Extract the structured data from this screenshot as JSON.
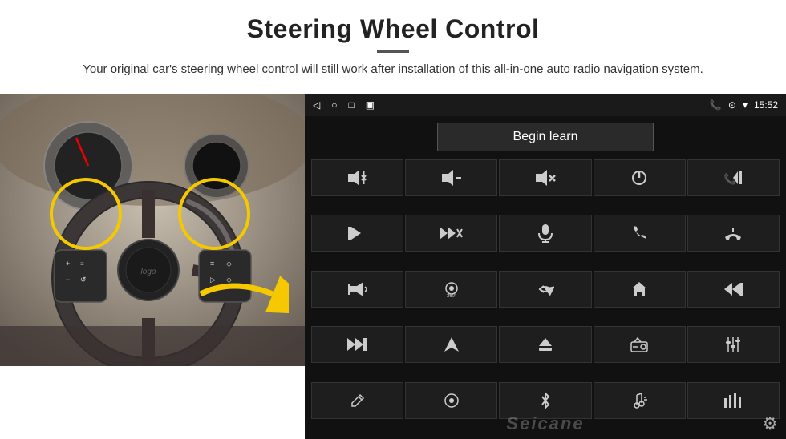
{
  "header": {
    "title": "Steering Wheel Control",
    "subtitle": "Your original car's steering wheel control will still work after installation of this all-in-one auto radio navigation system."
  },
  "status_bar": {
    "time": "15:52",
    "back_icon": "◁",
    "home_icon": "○",
    "recents_icon": "□",
    "sd_icon": "▣",
    "phone_icon": "📞",
    "location_icon": "⊙",
    "wifi_icon": "▾"
  },
  "begin_learn": {
    "label": "Begin learn"
  },
  "grid_icons": [
    {
      "icon": "🔊+",
      "name": "volume-up"
    },
    {
      "icon": "🔊−",
      "name": "volume-down"
    },
    {
      "icon": "🔇",
      "name": "mute"
    },
    {
      "icon": "⏻",
      "name": "power"
    },
    {
      "icon": "⏮",
      "name": "prev-track-phone"
    },
    {
      "icon": "⏭",
      "name": "next-track"
    },
    {
      "icon": "⏭✕",
      "name": "skip-next-x"
    },
    {
      "icon": "🎙",
      "name": "microphone"
    },
    {
      "icon": "📞",
      "name": "call"
    },
    {
      "icon": "↩",
      "name": "hang-up"
    },
    {
      "icon": "🔔",
      "name": "horn"
    },
    {
      "icon": "360°",
      "name": "camera-360"
    },
    {
      "icon": "↩",
      "name": "back"
    },
    {
      "icon": "⌂",
      "name": "home"
    },
    {
      "icon": "⏮⏮",
      "name": "prev-prev"
    },
    {
      "icon": "⏭⏭",
      "name": "fast-forward"
    },
    {
      "icon": "➤",
      "name": "navigate"
    },
    {
      "icon": "⊜",
      "name": "eject"
    },
    {
      "icon": "📻",
      "name": "radio"
    },
    {
      "icon": "≡|",
      "name": "eq-settings"
    },
    {
      "icon": "✏",
      "name": "learn-edit"
    },
    {
      "icon": "⊙",
      "name": "menu-circle"
    },
    {
      "icon": "✱",
      "name": "bluetooth"
    },
    {
      "icon": "🎵",
      "name": "music"
    },
    {
      "icon": "|||",
      "name": "equalizer"
    }
  ],
  "watermark": "Seicane",
  "gear_label": "⚙"
}
